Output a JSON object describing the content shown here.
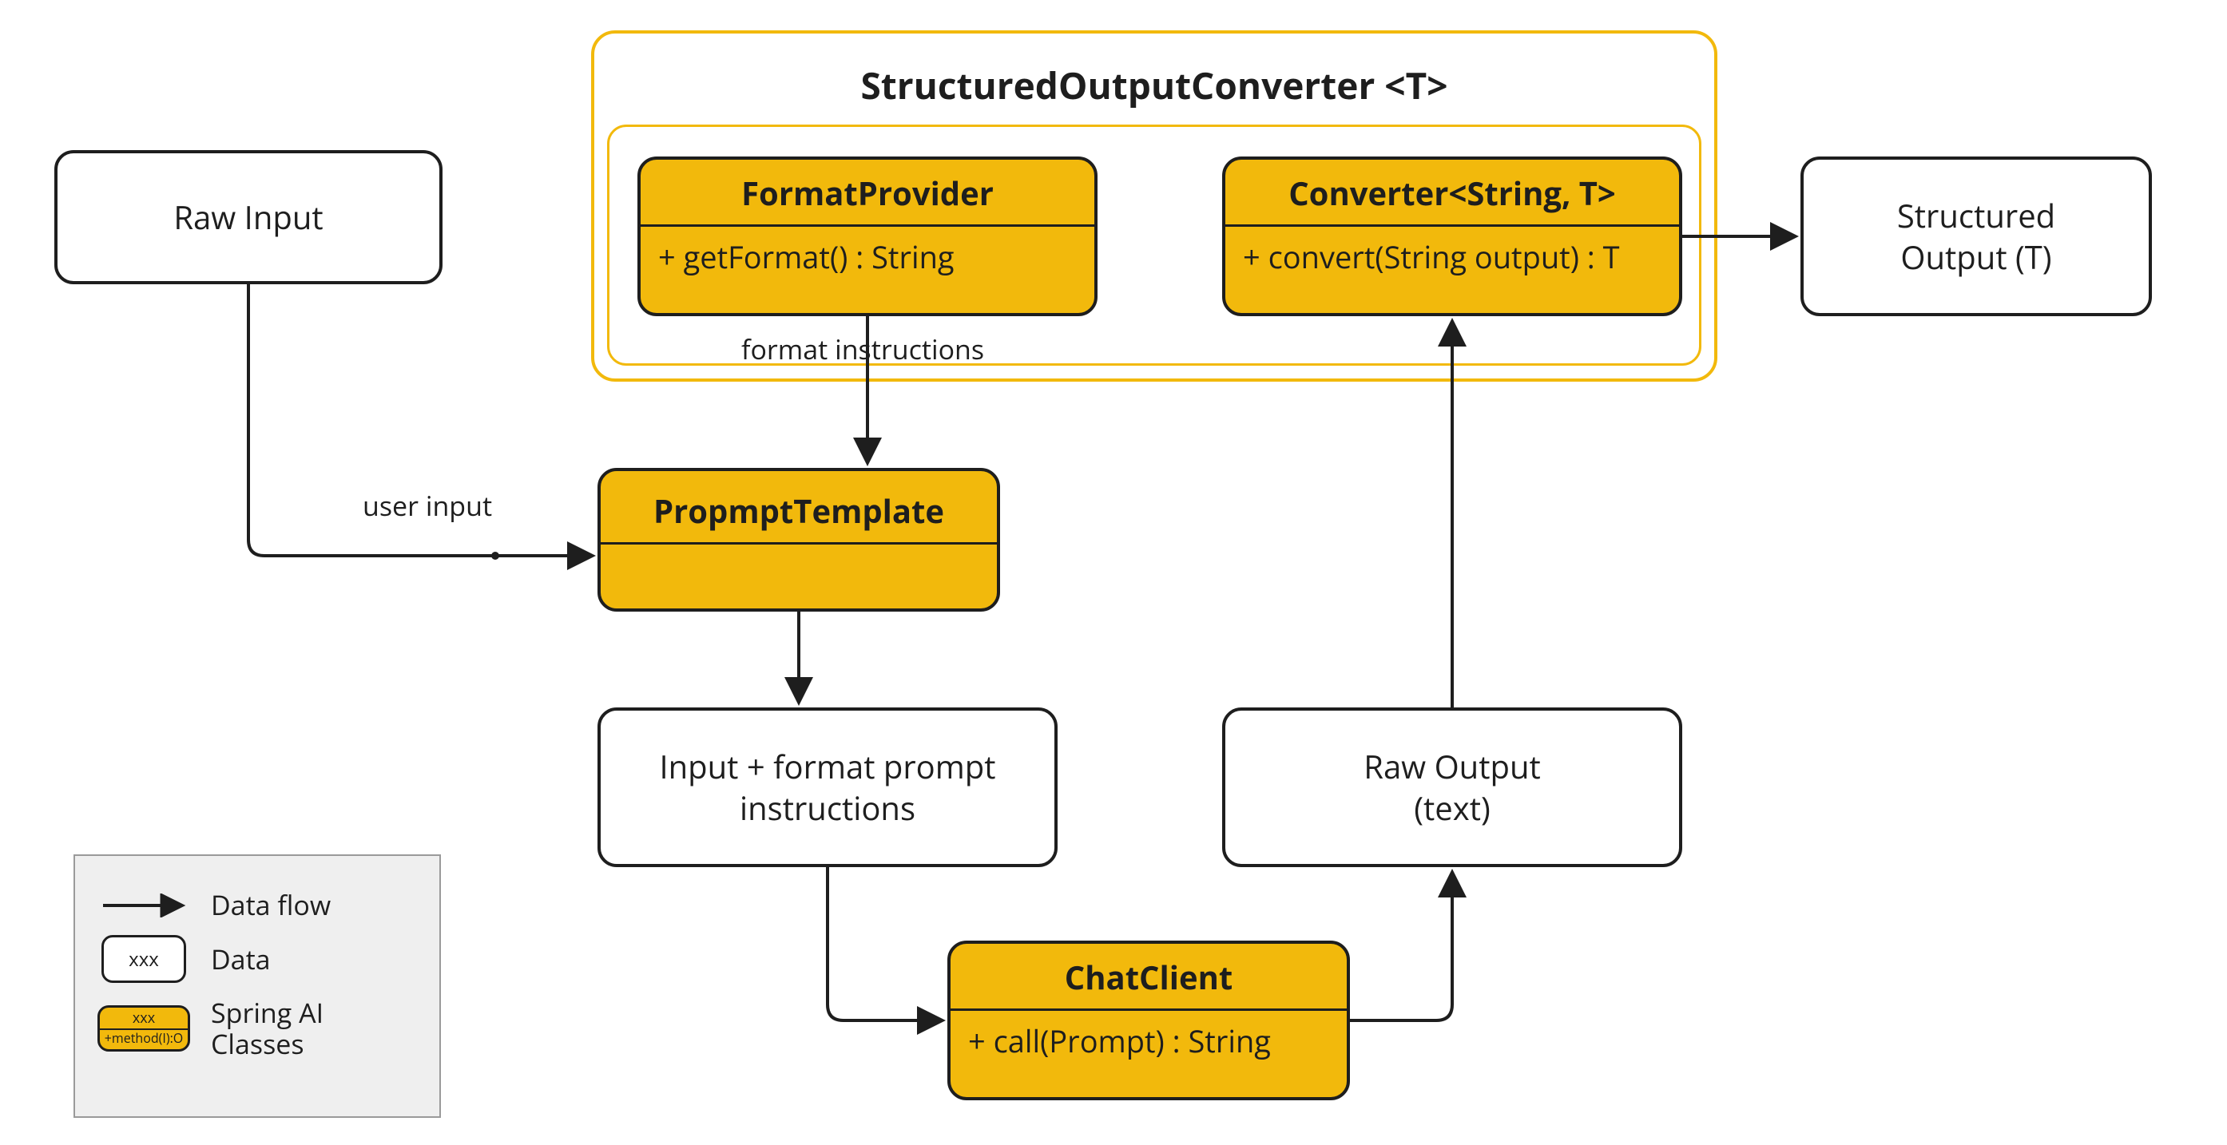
{
  "container": {
    "title": "StructuredOutputConverter <T>"
  },
  "nodes": {
    "raw_input": {
      "line1": "Raw Input"
    },
    "format_provider": {
      "title": "FormatProvider",
      "method": "+ getFormat() : String"
    },
    "converter": {
      "title": "Converter<String, T>",
      "method": "+ convert(String output) : T"
    },
    "structured_output": {
      "line1": "Structured",
      "line2": "Output (T)"
    },
    "prompt_template": {
      "title": "PropmptTemplate"
    },
    "combined_prompt": {
      "line1": "Input + format prompt",
      "line2": "instructions"
    },
    "chat_client": {
      "title": "ChatClient",
      "method": "+ call(Prompt) : String"
    },
    "raw_output": {
      "line1": "Raw Output",
      "line2": "(text)"
    }
  },
  "edge_labels": {
    "user_input": "user input",
    "format_instructions": "format instructions"
  },
  "legend": {
    "data_flow": "Data flow",
    "data": "Data",
    "data_icon_text": "xxx",
    "class_icon_header": "xxx",
    "class_icon_body": "+method(I):O",
    "spring_ai_line1": "Spring AI",
    "spring_ai_line2": "Classes"
  }
}
